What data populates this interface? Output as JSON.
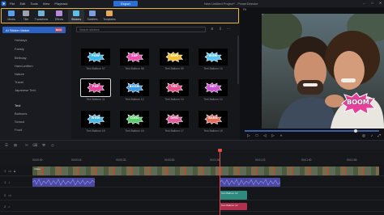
{
  "titlebar": {
    "menu": [
      "File",
      "Edit",
      "Tools",
      "View",
      "Playback"
    ],
    "export_label": "Export",
    "title": "New Untitled Project* - PowerDirector"
  },
  "toolbar": {
    "tools": [
      {
        "label": "Media",
        "icon": "media-icon",
        "color": "#5aa0e8"
      },
      {
        "label": "Title",
        "icon": "title-icon",
        "color": "#9fa3ab"
      },
      {
        "label": "Transitions",
        "icon": "transitions-icon",
        "color": "#6fb3d9"
      },
      {
        "label": "Effects",
        "icon": "effects-icon",
        "color": "#b58be0"
      },
      {
        "label": "Stickers",
        "icon": "stickers-icon",
        "color": "#5bc0e8"
      },
      {
        "label": "Subtitles",
        "icon": "subtitles-icon",
        "color": "#7a9ee0"
      },
      {
        "label": "Templates",
        "icon": "templates-icon",
        "color": "#e6a95a"
      }
    ]
  },
  "sidebar": {
    "selected": "AI Sticker Maker",
    "selected_badge": "BETA",
    "items": [
      "Holidays",
      "Family",
      "Birthday",
      "Hand-written",
      "Nature",
      "Travel",
      "Japanese Text",
      "Text",
      "Balloons",
      "School",
      "Food"
    ],
    "active_item": "Text"
  },
  "grid": {
    "search_placeholder": "Search stickers",
    "tiles": [
      {
        "label": "Text Balloon 07",
        "word": "POW",
        "fill": "#3db8e8"
      },
      {
        "label": "Text Balloon 08",
        "word": "ZAP",
        "fill": "#ec4fb0"
      },
      {
        "label": "Text Balloon 09",
        "word": "BAM",
        "fill": "#f2c230"
      },
      {
        "label": "Text Balloon 10",
        "word": "WOW",
        "fill": "#56c7f0"
      },
      {
        "label": "Text Balloon 11",
        "word": "POP",
        "fill": "#e2459a"
      },
      {
        "label": "Text Balloon 12",
        "word": "BOOM",
        "fill": "#3a9be8"
      },
      {
        "label": "Text Balloon 13",
        "word": "YES",
        "fill": "#e84f8a"
      },
      {
        "label": "Text Balloon 14",
        "word": "HEY",
        "fill": "#cf53d6"
      },
      {
        "label": "Text Balloon 15",
        "word": "WOW",
        "fill": "#45b9e8"
      },
      {
        "label": "Text Balloon 16",
        "word": "COOL",
        "fill": "#58d06a"
      },
      {
        "label": "Text Balloon 17",
        "word": "OMG",
        "fill": "#e65a9e"
      },
      {
        "label": "Text Balloon 18",
        "word": "BANG",
        "fill": "#e86b5a"
      }
    ]
  },
  "preview": {
    "mode_label": "Fit",
    "sticker_word": "BOOM"
  },
  "timeline": {
    "ruler_ticks": [
      "00:00:00",
      "00:00:16",
      "00:00:33",
      "00:00:50",
      "00:01:06",
      "00:01:23",
      "00:01:40",
      "00:01:56"
    ],
    "tracks": [
      {
        "num": "1",
        "kind": "video"
      },
      {
        "num": "1",
        "kind": "audio"
      },
      {
        "num": "2",
        "kind": "video"
      },
      {
        "num": "2",
        "kind": "audio"
      }
    ],
    "clip_labels": {
      "video1": "Video",
      "sticker": "Text Balloon 12",
      "title": "Text Balloon 12"
    }
  }
}
